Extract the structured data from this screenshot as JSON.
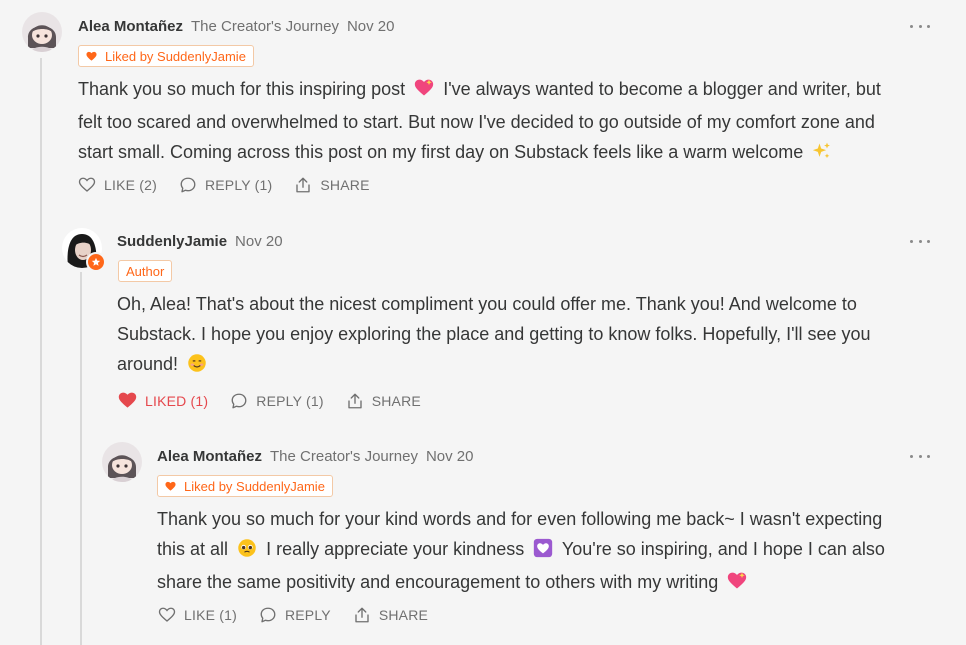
{
  "colors": {
    "accent": "#ff6719",
    "liked": "#e5484d",
    "text": "#363737",
    "muted": "#707070"
  },
  "comments": [
    {
      "author": "Alea Montañez",
      "publication": "The Creator's Journey",
      "date": "Nov 20",
      "badge": "Liked by SuddenlyJamie",
      "body": [
        "Thank you so much for this inspiring post",
        "I've always wanted to become a blogger and writer, but",
        "felt too scared and overwhelmed to start. But now I've decided to go outside of my comfort zone and",
        "start small. Coming across this post on my first day on Substack feels like a warm welcome"
      ],
      "emojis": [
        "sparkling-heart-emoji",
        "sparkles-emoji"
      ],
      "like_label": "LIKE (2)",
      "reply_label": "REPLY (1)",
      "share_label": "SHARE"
    },
    {
      "author": "SuddenlyJamie",
      "date": "Nov 20",
      "badge": "Author",
      "body": [
        "Oh, Alea! That's about the nicest compliment you could offer me. Thank you! And welcome to",
        "Substack. I hope you enjoy exploring the place and getting to know folks. Hopefully, I'll see you",
        "around!"
      ],
      "emojis": [
        "smiling-face-emoji"
      ],
      "like_label": "LIKED (1)",
      "reply_label": "REPLY (1)",
      "share_label": "SHARE"
    },
    {
      "author": "Alea Montañez",
      "publication": "The Creator's Journey",
      "date": "Nov 20",
      "badge": "Liked by SuddenlyJamie",
      "body": [
        "Thank you so much for your kind words and for even following me back~ I wasn't expecting",
        "this at all",
        "I really appreciate your kindness",
        "You're so inspiring, and I hope I can also",
        "share the same positivity and encouragement to others with my writing"
      ],
      "emojis": [
        "pleading-face-emoji",
        "purple-heart-emoji",
        "sparkling-heart-emoji"
      ],
      "like_label": "LIKE (1)",
      "reply_label": "REPLY",
      "share_label": "SHARE"
    }
  ]
}
